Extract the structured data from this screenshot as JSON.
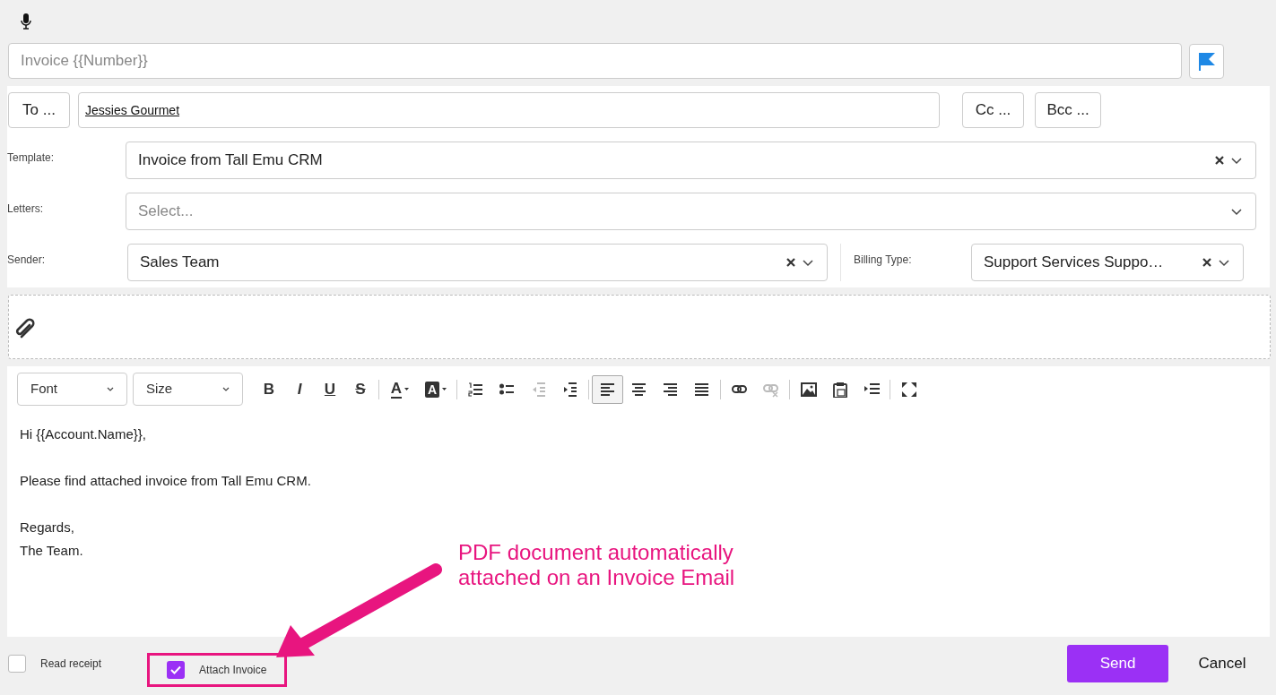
{
  "subject": {
    "placeholder": "Invoice {{Number}}"
  },
  "recipients": {
    "to_button": "To ...",
    "to_value": "Jessies Gourmet",
    "cc_button": "Cc ...",
    "bcc_button": "Bcc ..."
  },
  "fields": [
    {
      "label": "Template:",
      "value": "Invoice from Tall Emu CRM",
      "clearable": true
    },
    {
      "label": "Letters:",
      "placeholder": "Select...",
      "clearable": false
    }
  ],
  "sender": {
    "label": "Sender:",
    "value": "Sales Team",
    "clearable": true
  },
  "billing_type": {
    "label": "Billing Type:",
    "value": "Support Services Suppo…",
    "clearable": true
  },
  "toolbar": {
    "font": "Font",
    "size": "Size",
    "groups": [
      [
        {
          "kind": "bold",
          "label": "B",
          "disabled": false,
          "selected": false
        },
        {
          "kind": "italic",
          "label": "I",
          "disabled": false,
          "selected": false
        },
        {
          "kind": "underline",
          "label": "U",
          "disabled": false,
          "selected": false
        },
        {
          "kind": "strike",
          "label": "S",
          "disabled": false,
          "selected": false
        }
      ],
      [
        {
          "kind": "textcolor",
          "label": "A",
          "disabled": false,
          "selected": false
        },
        {
          "kind": "bgcolor",
          "label": "A",
          "disabled": false,
          "selected": false
        }
      ],
      [
        {
          "kind": "ol",
          "disabled": false,
          "selected": false
        },
        {
          "kind": "ul",
          "disabled": false,
          "selected": false
        },
        {
          "kind": "outdent",
          "disabled": true,
          "selected": false
        },
        {
          "kind": "indent",
          "disabled": false,
          "selected": false
        }
      ],
      [
        {
          "kind": "alignleft",
          "disabled": false,
          "selected": true
        },
        {
          "kind": "aligncenter",
          "disabled": false,
          "selected": false
        },
        {
          "kind": "alignright",
          "disabled": false,
          "selected": false
        },
        {
          "kind": "justify",
          "disabled": false,
          "selected": false
        }
      ],
      [
        {
          "kind": "link",
          "disabled": false,
          "selected": false
        },
        {
          "kind": "unlink",
          "disabled": true,
          "selected": false
        }
      ],
      [
        {
          "kind": "image",
          "disabled": false,
          "selected": false
        },
        {
          "kind": "pasteword",
          "disabled": false,
          "selected": false
        },
        {
          "kind": "blocks",
          "disabled": false,
          "selected": false
        }
      ],
      [
        {
          "kind": "maximize",
          "disabled": false,
          "selected": false
        }
      ]
    ]
  },
  "body": [
    [
      "Hi {{Account.Name}},"
    ],
    [
      "Please find attached invoice from Tall Emu CRM."
    ],
    [
      "Regards,",
      "The Team."
    ]
  ],
  "footer": {
    "options": [
      {
        "label": "Read receipt",
        "checked": false,
        "highlighted": false
      },
      {
        "label": "Attach Invoice",
        "checked": true,
        "highlighted": true
      }
    ],
    "send": "Send",
    "cancel": "Cancel"
  },
  "annotation": {
    "lines": [
      "PDF document automatically",
      "attached on an Invoice Email"
    ]
  }
}
